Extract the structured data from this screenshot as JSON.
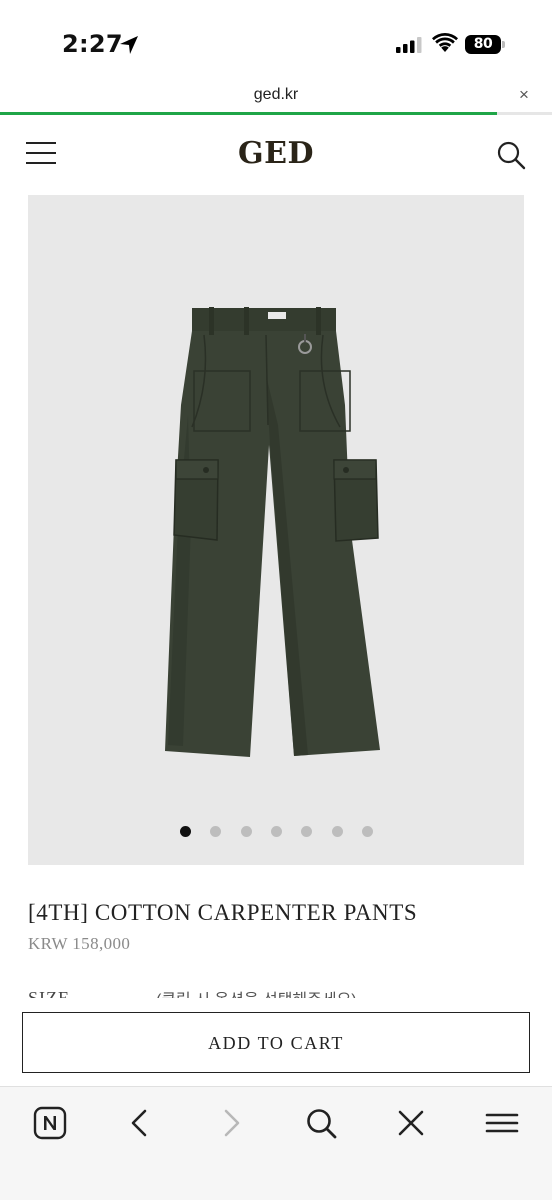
{
  "status_bar": {
    "time": "2:27",
    "battery": "80"
  },
  "browser": {
    "url": "ged.kr",
    "close_label": "×",
    "load_progress": 0.9
  },
  "site": {
    "logo": "GED"
  },
  "gallery": {
    "image_count": 7,
    "active_index": 0
  },
  "product": {
    "title": "[4TH] COTTON CARPENTER PANTS",
    "price": "KRW 158,000",
    "size_label": "SIZE",
    "size_note": "(클릭 시 옵션을 선택해주세요)"
  },
  "actions": {
    "add_to_cart": "ADD TO CART"
  },
  "toolbar": {
    "items": [
      "naver-n",
      "back",
      "forward",
      "search",
      "close",
      "menu"
    ]
  }
}
